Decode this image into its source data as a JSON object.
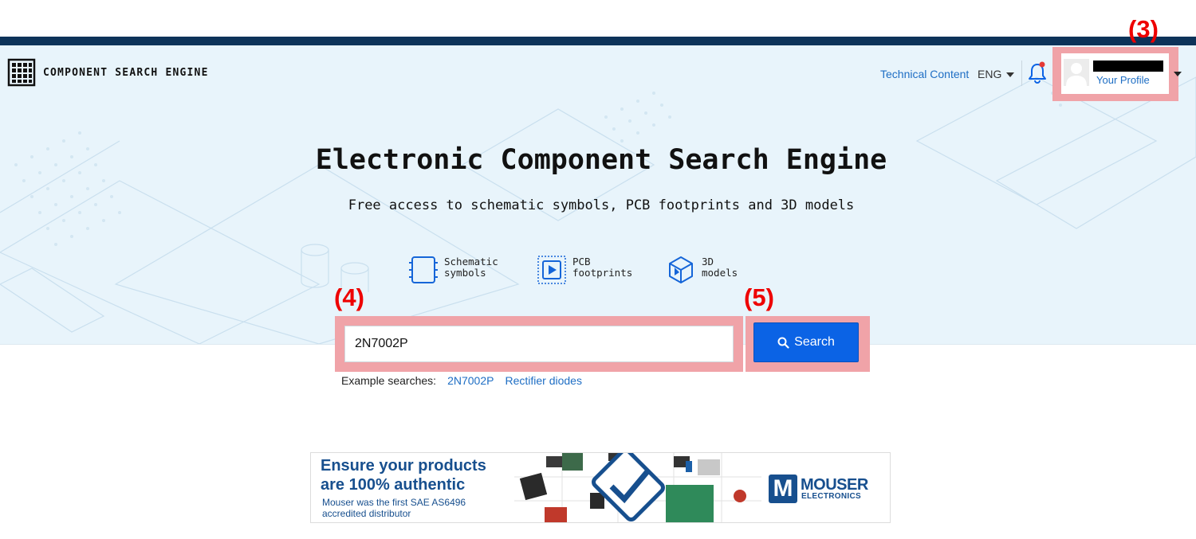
{
  "header": {
    "brand": "COMPONENT SEARCH ENGINE",
    "technical_content": "Technical Content",
    "language": "ENG",
    "profile_link": "Your Profile"
  },
  "annotations": {
    "profile": "(3)",
    "search_input": "(4)",
    "search_button": "(5)"
  },
  "hero": {
    "title": "Electronic Component Search Engine",
    "subtitle": "Free access to schematic symbols, PCB footprints and 3D models"
  },
  "features": [
    {
      "line1": "Schematic",
      "line2": "symbols",
      "icon": "schematic-icon"
    },
    {
      "line1": "PCB",
      "line2": "footprints",
      "icon": "pcb-footprint-icon"
    },
    {
      "line1": "3D",
      "line2": "models",
      "icon": "3d-model-icon"
    }
  ],
  "search": {
    "value": "2N7002P",
    "button_label": "Search",
    "examples_label": "Example searches:",
    "examples": [
      "2N7002P",
      "Rectifier diodes"
    ]
  },
  "ad": {
    "headline_1": "Ensure your products",
    "headline_2": "are 100% authentic",
    "body_1": "Mouser was the first SAE AS6496",
    "body_2": "accredited distributor",
    "brand": "MOUSER",
    "brand_sub": "ELECTRONICS",
    "brand_mark": "M"
  },
  "colors": {
    "accent": "#0b63e5",
    "top_bar": "#0d3359",
    "hero_bg": "#e8f4fb",
    "link": "#1e6ec4",
    "annotation": "#ee0000",
    "highlight": "#f0a3a8"
  }
}
